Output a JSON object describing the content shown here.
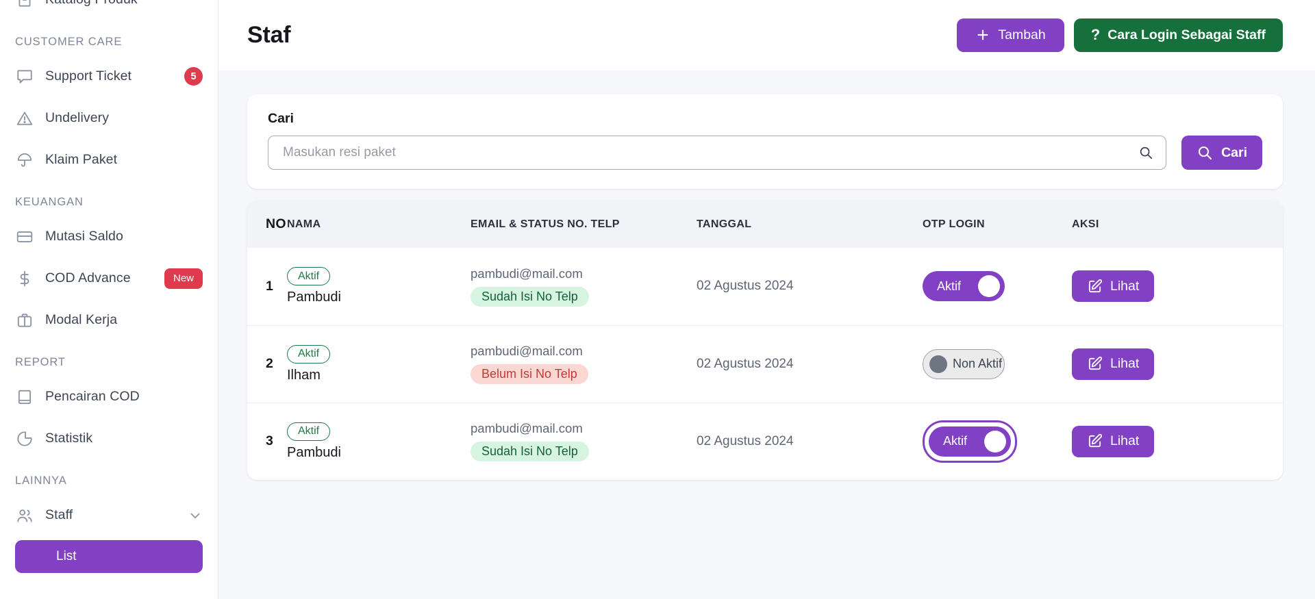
{
  "sidebar": {
    "top_item": {
      "label": "Katalog Produk",
      "icon": "archive-icon"
    },
    "groups": [
      {
        "title": "CUSTOMER CARE",
        "items": [
          {
            "label": "Support Ticket",
            "icon": "chat-icon",
            "badge": "5",
            "badge_type": "count"
          },
          {
            "label": "Undelivery",
            "icon": "warning-triangle-icon"
          },
          {
            "label": "Klaim Paket",
            "icon": "umbrella-icon"
          }
        ]
      },
      {
        "title": "KEUANGAN",
        "items": [
          {
            "label": "Mutasi Saldo",
            "icon": "card-icon"
          },
          {
            "label": "COD Advance",
            "icon": "dollar-icon",
            "badge": "New",
            "badge_type": "new"
          },
          {
            "label": "Modal Kerja",
            "icon": "briefcase-icon"
          }
        ]
      },
      {
        "title": "REPORT",
        "items": [
          {
            "label": "Pencairan COD",
            "icon": "book-icon"
          },
          {
            "label": "Statistik",
            "icon": "pie-chart-icon"
          }
        ]
      },
      {
        "title": "LAINNYA",
        "items": [
          {
            "label": "Staff",
            "icon": "users-icon",
            "expandable": true
          }
        ]
      }
    ],
    "active_subitem": {
      "label": "List"
    }
  },
  "header": {
    "title": "Staf",
    "add_button": {
      "label": "Tambah",
      "icon": "plus-icon",
      "color": "#8241c4"
    },
    "help_button": {
      "label": "Cara Login Sebagai Staff",
      "icon": "question-mark-icon",
      "color": "#16703c"
    }
  },
  "search": {
    "label": "Cari",
    "placeholder": "Masukan resi paket",
    "value": "",
    "input_icon": "search-icon",
    "button_label": "Cari",
    "button_icon": "search-icon"
  },
  "table": {
    "columns": [
      "NO",
      "NAMA",
      "EMAIL & STATUS NO. TELP",
      "TANGGAL",
      "OTP LOGIN",
      "AKSI"
    ],
    "rows": [
      {
        "no": "1",
        "status_chip": "Aktif",
        "name": "Pambudi",
        "email": "pambudi@mail.com",
        "phone_status": "Sudah Isi No Telp",
        "phone_status_type": "ok",
        "date": "02 Agustus 2024",
        "otp_label": "Aktif",
        "otp_on": true,
        "otp_focused": false,
        "action_label": "Lihat",
        "action_icon": "edit-square-icon"
      },
      {
        "no": "2",
        "status_chip": "Aktif",
        "name": "Ilham",
        "email": "pambudi@mail.com",
        "phone_status": "Belum Isi No Telp",
        "phone_status_type": "none",
        "date": "02 Agustus 2024",
        "otp_label": "Non Aktif",
        "otp_on": false,
        "otp_focused": false,
        "action_label": "Lihat",
        "action_icon": "edit-square-icon"
      },
      {
        "no": "3",
        "status_chip": "Aktif",
        "name": "Pambudi",
        "email": "pambudi@mail.com",
        "phone_status": "Sudah Isi No Telp",
        "phone_status_type": "ok",
        "date": "02 Agustus 2024",
        "otp_label": "Aktif",
        "otp_on": true,
        "otp_focused": true,
        "action_label": "Lihat",
        "action_icon": "edit-square-icon"
      }
    ]
  },
  "colors": {
    "accent_purple": "#8241c4",
    "green": "#16703c",
    "red_badge": "#e03a4e",
    "page_bg": "#f6f7fa",
    "chip_green_bg": "#d6f4e0",
    "chip_red_bg": "#fbd7d4"
  }
}
